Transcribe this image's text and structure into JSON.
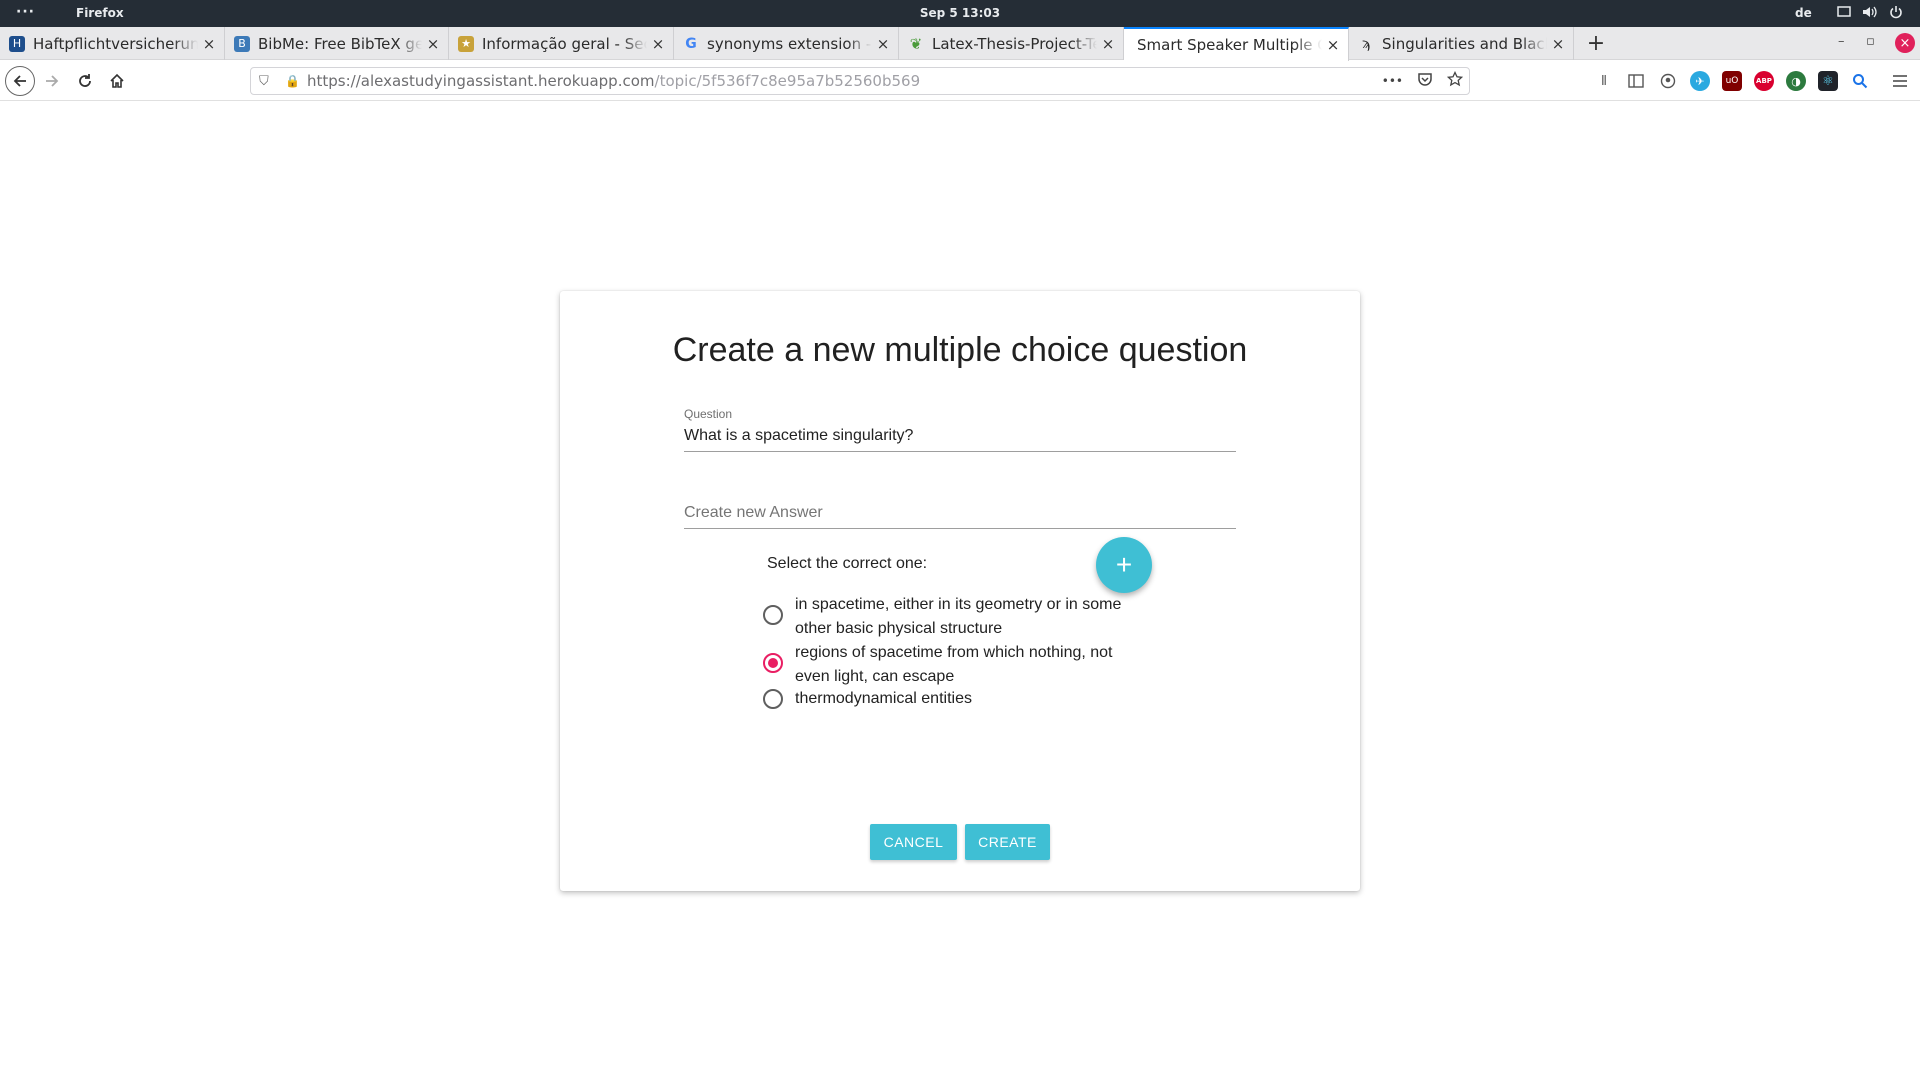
{
  "system": {
    "dots": "···",
    "app_name": "Firefox",
    "clock": "Sep 5  13:03",
    "lang": "de"
  },
  "tabs": [
    {
      "title": "Haftpflichtversicherung -",
      "close": "×",
      "favicon_color": "#1e4e8c"
    },
    {
      "title": "BibMe: Free BibTeX gene",
      "close": "×",
      "favicon_color": "#3d7ab8"
    },
    {
      "title": "Informação geral - Secção",
      "close": "×",
      "favicon_color": "#c8a23a"
    },
    {
      "title": "synonyms extension - Go",
      "close": "×",
      "favicon_color": "#4285f4"
    },
    {
      "title": "Latex-Thesis-Project-Ten",
      "close": "×",
      "favicon_color": "#4a9b3a"
    },
    {
      "title": "Smart Speaker Multiple Cho",
      "close": "×",
      "favicon_color": "#ffffff"
    },
    {
      "title": "Singularities and Black Ho",
      "close": "×",
      "favicon_color": "#333333"
    }
  ],
  "new_tab": "+",
  "window_controls": {
    "minimize": "–",
    "restore": "▫",
    "close": "×"
  },
  "urlbar": {
    "host": "https://alexastudyingassistant.herokuapp.com",
    "path": "/topic/5f536f7c8e95a7b52560b569",
    "more": "•••"
  },
  "toolbar_icons": [
    {
      "name": "library-icon",
      "glyph": "|||\\",
      "color": "#555555"
    },
    {
      "name": "sidebar-icon",
      "glyph": "▥",
      "color": "#555555"
    },
    {
      "name": "account-icon",
      "glyph": "◉",
      "color": "#555555"
    },
    {
      "name": "bird-extension-icon",
      "glyph": "✈",
      "color": "#2aa9e0"
    },
    {
      "name": "ublock-icon",
      "glyph": "uO",
      "color": "#800000"
    },
    {
      "name": "adblock-icon",
      "glyph": "ABP",
      "color": "#d9002f"
    },
    {
      "name": "vpn-icon",
      "glyph": "◑",
      "color": "#2c7a3e"
    },
    {
      "name": "react-devtools-icon",
      "glyph": "⚛",
      "color": "#20232a"
    },
    {
      "name": "search-extension-icon",
      "glyph": "⌕",
      "color": "#1a73e8"
    },
    {
      "name": "menu-icon",
      "glyph": "≡",
      "color": "#555555"
    }
  ],
  "dialog": {
    "title": "Create a new multiple choice question",
    "question_label": "Question",
    "question_value": "What is a spacetime singularity?",
    "answer_placeholder": "Create new Answer",
    "select_label": "Select the correct one:",
    "add_button": "+",
    "options": [
      {
        "text": "in spacetime, either in its geometry or in some other basic physical structure",
        "checked": false
      },
      {
        "text": "regions of spacetime from which nothing, not even light, can escape",
        "checked": true
      },
      {
        "text": "thermodynamical entities",
        "checked": false
      }
    ],
    "cancel_label": "CANCEL",
    "create_label": "CREATE",
    "accent_color": "#3fbfd4",
    "radio_checked_color": "#e91e63"
  }
}
